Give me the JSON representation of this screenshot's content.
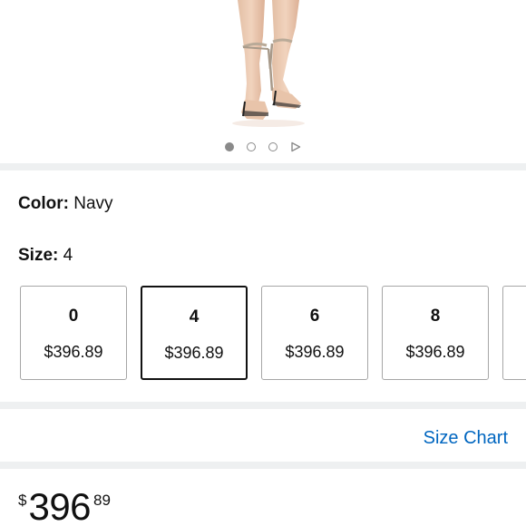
{
  "product_image": {
    "alt": "Nude ankle-strap high heel sandal"
  },
  "carousel": {
    "dots": 3,
    "active_index": 0
  },
  "color": {
    "label": "Color:",
    "value": "Navy"
  },
  "size": {
    "label": "Size:",
    "value": "4",
    "options": [
      {
        "name": "0",
        "price": "$396.89",
        "selected": false
      },
      {
        "name": "4",
        "price": "$396.89",
        "selected": true
      },
      {
        "name": "6",
        "price": "$396.89",
        "selected": false
      },
      {
        "name": "8",
        "price": "$396.89",
        "selected": false
      }
    ]
  },
  "size_chart": {
    "label": "Size Chart",
    "color": "#0066c0"
  },
  "price": {
    "symbol": "$",
    "whole": "396",
    "fraction": "89"
  }
}
